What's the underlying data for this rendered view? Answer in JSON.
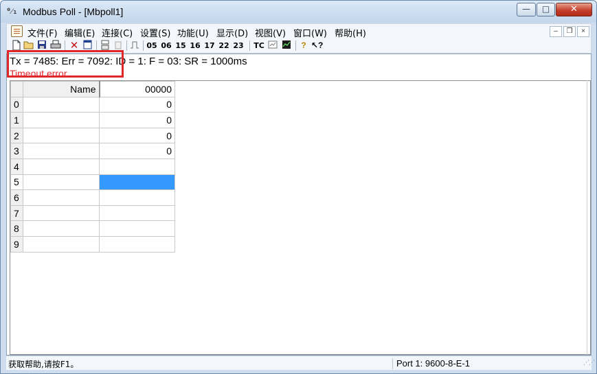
{
  "window": {
    "title": "Modbus Poll - [Mbpoll1]",
    "icon": "modbus-app-icon",
    "minimize_glyph": "—",
    "maximize_glyph": "□",
    "close_glyph": "✕"
  },
  "menu": {
    "items": [
      {
        "label": "文件(F)"
      },
      {
        "label": "编辑(E)"
      },
      {
        "label": "连接(C)"
      },
      {
        "label": "设置(S)"
      },
      {
        "label": "功能(U)"
      },
      {
        "label": "显示(D)"
      },
      {
        "label": "视图(V)"
      },
      {
        "label": "窗口(W)"
      },
      {
        "label": "帮助(H)"
      }
    ],
    "mdi_minimize": "–",
    "mdi_restore": "❐",
    "mdi_close": "×"
  },
  "toolbar": {
    "function_codes": [
      "05",
      "06",
      "15",
      "16",
      "17",
      "22",
      "23"
    ],
    "tc_label": "TC"
  },
  "poll_status": {
    "line": "Tx = 7485: Err = 7092: ID = 1: F = 03: SR = 1000ms",
    "error": "Timeout error",
    "highlight_color": "#e1262a"
  },
  "grid": {
    "headers": {
      "name": "Name",
      "address": "00000"
    },
    "rows": [
      {
        "index": "0",
        "name": "",
        "value": "0"
      },
      {
        "index": "1",
        "name": "",
        "value": "0"
      },
      {
        "index": "2",
        "name": "",
        "value": "0"
      },
      {
        "index": "3",
        "name": "",
        "value": "0"
      },
      {
        "index": "4",
        "name": "",
        "value": ""
      },
      {
        "index": "5",
        "name": "",
        "value": ""
      },
      {
        "index": "6",
        "name": "",
        "value": ""
      },
      {
        "index": "7",
        "name": "",
        "value": ""
      },
      {
        "index": "8",
        "name": "",
        "value": ""
      },
      {
        "index": "9",
        "name": "",
        "value": ""
      }
    ],
    "selected_row": 5,
    "selection_color": "#3399ff"
  },
  "statusbar": {
    "help": "获取帮助,请按F1。",
    "port": "Port 1: 9600-8-E-1"
  }
}
